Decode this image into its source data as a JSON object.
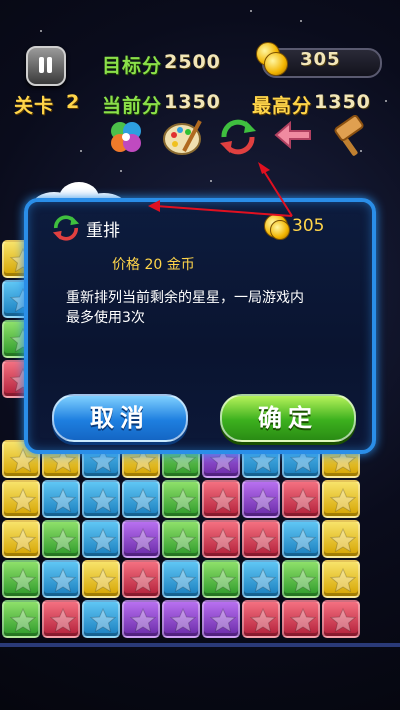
{
  "hud": {
    "target_label": "目标分",
    "target_value": "2500",
    "coins": "305",
    "level_label": "关卡",
    "level_value": "2",
    "current_label": "当前分",
    "current_value": "1350",
    "best_label": "最高分",
    "best_value": "1350"
  },
  "tools": [
    "clover-icon",
    "palette-icon",
    "refresh-icon",
    "undo-arrow-icon",
    "hammer-icon"
  ],
  "dialog": {
    "title": "重排",
    "coins": "305",
    "price": "价格 20 金币",
    "description": "重新排列当前剩余的星星，一局游戏内最多使用3次",
    "cancel_label": "取消",
    "confirm_label": "确定"
  },
  "colors": {
    "dialog_border": "#2a8ee8",
    "annotation_arrow": "#e01020"
  }
}
